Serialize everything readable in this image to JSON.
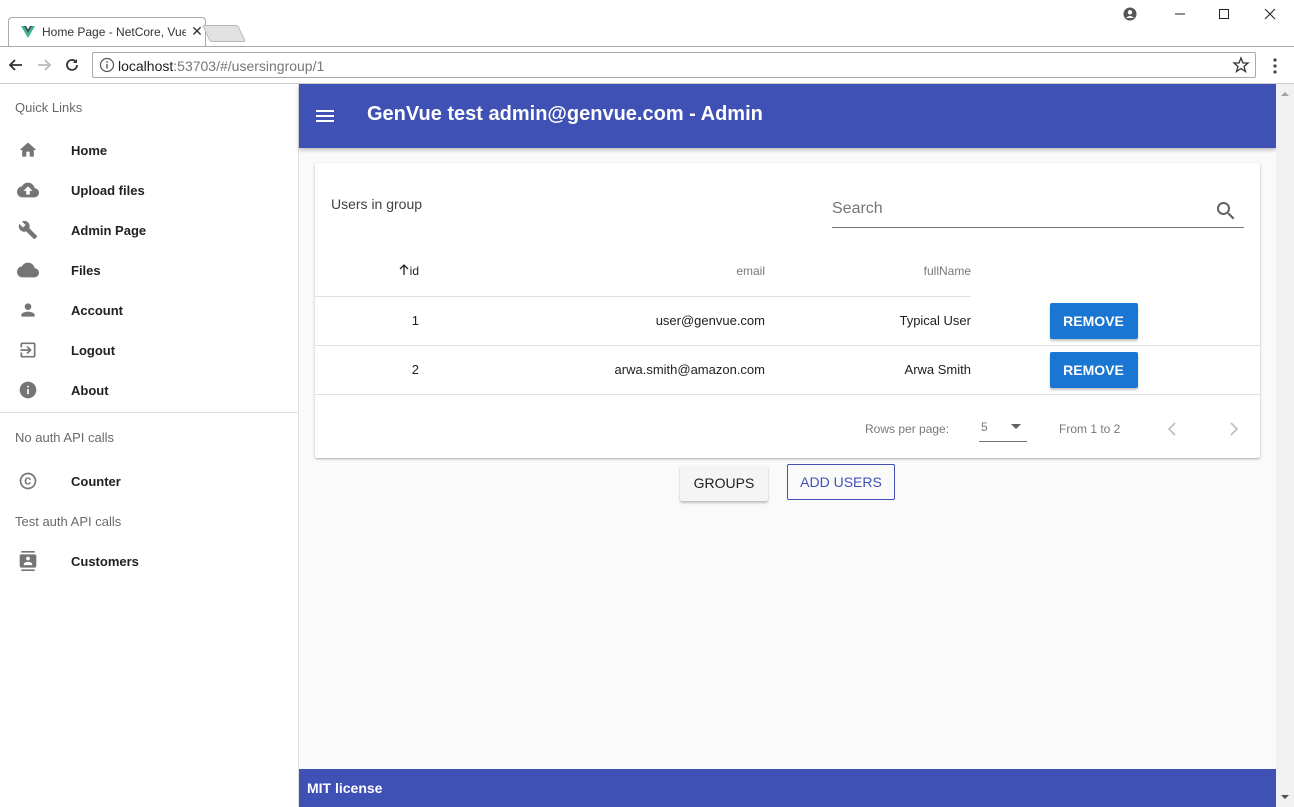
{
  "browser": {
    "tab_title": "Home Page - NetCore, Vue",
    "url_host": "localhost",
    "url_rest": ":53703/#/usersingroup/1"
  },
  "drawer": {
    "section1": "Quick Links",
    "quick_links": [
      {
        "label": "Home",
        "icon": "home-icon"
      },
      {
        "label": "Upload files",
        "icon": "cloud-upload-icon"
      },
      {
        "label": "Admin Page",
        "icon": "wrench-icon"
      },
      {
        "label": "Files",
        "icon": "cloud-icon"
      },
      {
        "label": "Account",
        "icon": "person-icon"
      },
      {
        "label": "Logout",
        "icon": "exit-icon"
      },
      {
        "label": "About",
        "icon": "info-icon"
      }
    ],
    "section2": "No auth API calls",
    "no_auth": [
      {
        "label": "Counter",
        "icon": "copyright-icon"
      }
    ],
    "section3": "Test auth API calls",
    "test_auth": [
      {
        "label": "Customers",
        "icon": "contacts-icon"
      }
    ]
  },
  "appbar": {
    "title": "GenVue test admin@genvue.com - Admin"
  },
  "card": {
    "title": "Users in group",
    "search_placeholder": "Search",
    "headers": {
      "id": "id",
      "email": "email",
      "fullName": "fullName"
    },
    "rows": [
      {
        "id": "1",
        "email": "user@genvue.com",
        "fullName": "Typical User",
        "action": "REMOVE"
      },
      {
        "id": "2",
        "email": "arwa.smith@amazon.com",
        "fullName": "Arwa Smith",
        "action": "REMOVE"
      }
    ],
    "rows_per_page_label": "Rows per page:",
    "rows_per_page_value": "5",
    "range_text": "From 1 to 2"
  },
  "actions": {
    "groups": "GROUPS",
    "add_users": "ADD USERS"
  },
  "footer": {
    "text": "MIT license"
  },
  "colors": {
    "primary": "#3f51b5",
    "button_blue": "#1976d2"
  }
}
